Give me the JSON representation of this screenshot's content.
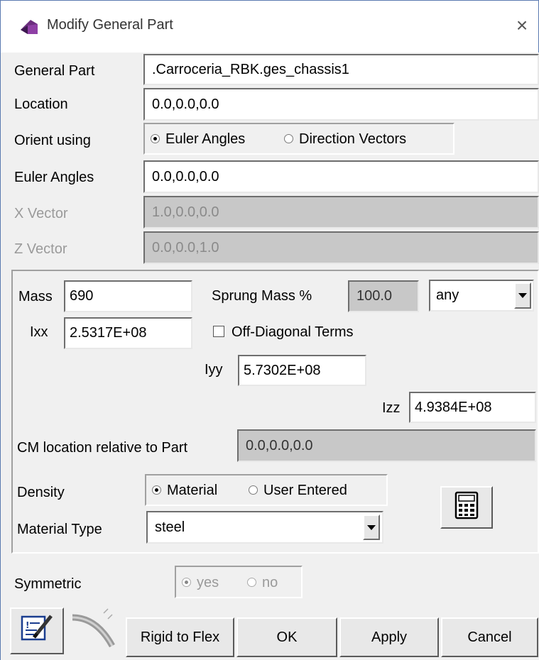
{
  "window": {
    "title": "Modify General Part",
    "close_icon": "×"
  },
  "general_part": {
    "label": "General Part",
    "value": ".Carroceria_RBK.ges_chassis1"
  },
  "location": {
    "label": "Location",
    "value": "0.0,0.0,0.0"
  },
  "orient": {
    "label": "Orient using",
    "options": [
      "Euler Angles",
      "Direction Vectors"
    ],
    "selected": "Euler Angles"
  },
  "euler_angles": {
    "label": "Euler Angles",
    "value": "0.0,0.0,0.0"
  },
  "x_vector": {
    "label": "X Vector",
    "value": "1.0,0.0,0.0"
  },
  "z_vector": {
    "label": "Z Vector",
    "value": "0.0,0.0,1.0"
  },
  "mass": {
    "label": "Mass",
    "value": "690"
  },
  "sprung_mass": {
    "label": "Sprung Mass %",
    "value": "100.0",
    "mode": "any"
  },
  "ixx": {
    "label": "Ixx",
    "value": "2.5317E+08"
  },
  "off_diagonal": {
    "label": "Off-Diagonal Terms",
    "checked": false
  },
  "iyy": {
    "label": "Iyy",
    "value": "5.7302E+08"
  },
  "izz": {
    "label": "Izz",
    "value": "4.9384E+08"
  },
  "cm_location": {
    "label": "CM location relative to Part",
    "value": "0.0,0.0,0.0"
  },
  "density": {
    "label": "Density",
    "options": [
      "Material",
      "User Entered"
    ],
    "selected": "Material"
  },
  "material_type": {
    "label": "Material Type",
    "value": "steel"
  },
  "symmetric": {
    "label": "Symmetric",
    "options": [
      "yes",
      "no"
    ],
    "selected": "yes"
  },
  "buttons": {
    "rigid_to_flex": "Rigid to Flex",
    "ok": "OK",
    "apply": "Apply",
    "cancel": "Cancel"
  },
  "icons": {
    "app": "adams-cube-icon",
    "calculator": "calculator-icon",
    "edit_notes": "edit-notes-icon",
    "flex_body": "flex-body-icon"
  },
  "colors": {
    "window_bg": "#f0f0f0",
    "disabled_field": "#c8c8c8",
    "title_border": "#5a7ab0",
    "app_icon": "#6b2d7e"
  }
}
